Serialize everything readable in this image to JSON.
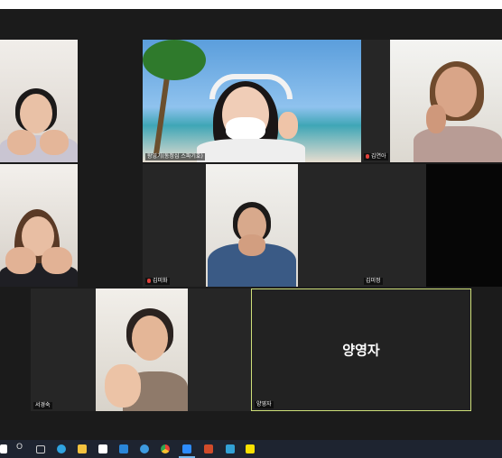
{
  "participants": [
    {
      "name": "",
      "muted": false
    },
    {
      "name": "왕영기(동정심 스파기호)",
      "muted": false
    },
    {
      "name": "김연아",
      "muted": true
    },
    {
      "name": "",
      "muted": false
    },
    {
      "name": "김미화",
      "muted": true
    },
    {
      "name": "김미정",
      "muted": false
    },
    {
      "name": "서경숙",
      "muted": false
    },
    {
      "name": "양영자",
      "muted": false
    }
  ],
  "active_speaker": {
    "display_name": "양영자",
    "label": "양영자"
  },
  "taskbar": {
    "search_glyph": "O",
    "icons": [
      "start-icon",
      "search-icon",
      "task-view-icon",
      "edge-icon",
      "file-explorer-icon",
      "store-icon",
      "mail-icon",
      "ie-icon",
      "chrome-icon",
      "zoom-icon",
      "powerpoint-icon",
      "chat-icon",
      "kakao-icon"
    ]
  },
  "colors": {
    "active_border": "#cfe07a",
    "stage_bg": "#1b1b1b",
    "taskbar_bg": "#1e2430"
  }
}
